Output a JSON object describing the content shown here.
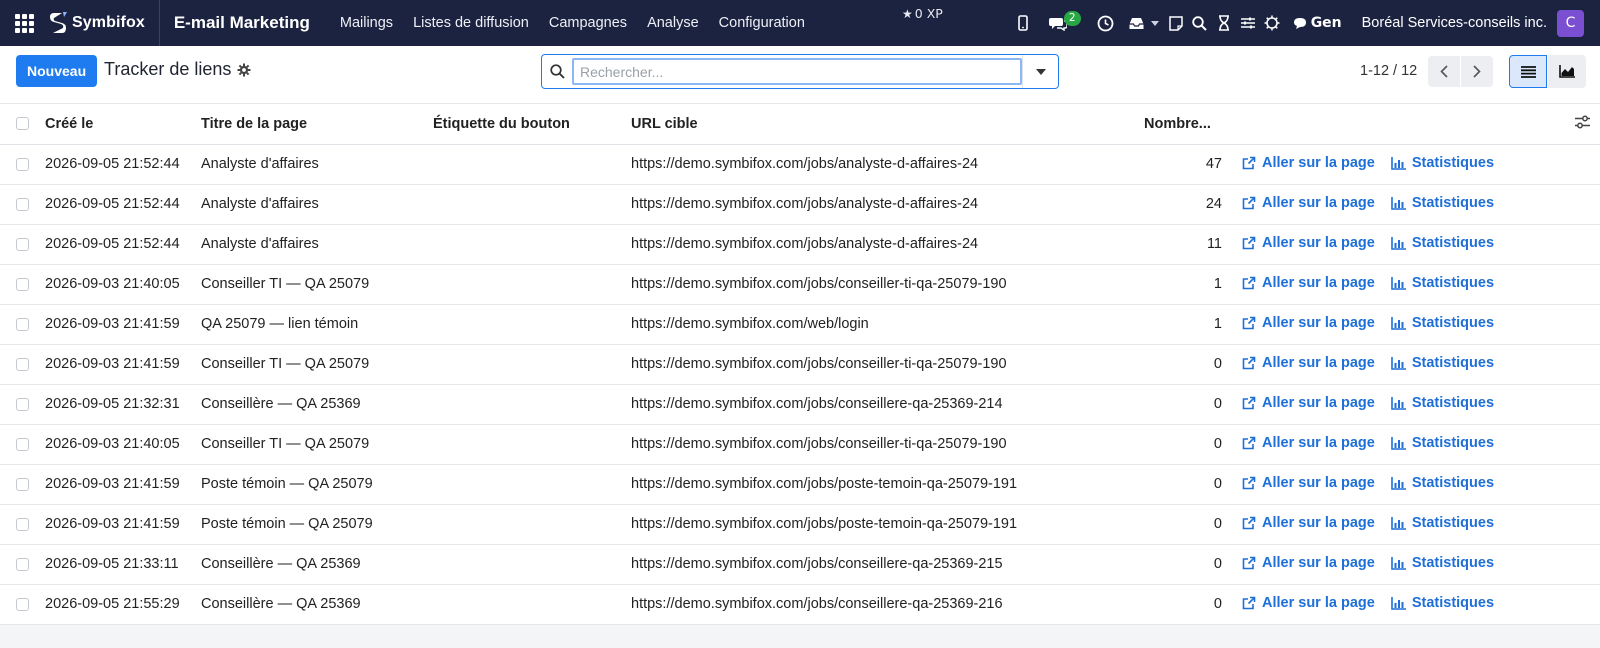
{
  "navbar": {
    "brand": "Symbifox",
    "app_title": "E-mail Marketing",
    "menu": [
      "Mailings",
      "Listes de diffusion",
      "Campagnes",
      "Analyse",
      "Configuration"
    ],
    "xp": "0 XP",
    "chat_count": "2",
    "gen_label": "Gen",
    "company": "Boréal Services-conseils inc.",
    "avatar_letter": "C"
  },
  "control": {
    "new_button": "Nouveau",
    "title": "Tracker de liens",
    "search_placeholder": "Rechercher...",
    "pager": "1-12 / 12"
  },
  "table": {
    "headers": {
      "created": "Créé le",
      "page_title": "Titre de la page",
      "button_label": "Étiquette du bouton",
      "target_url": "URL cible",
      "count": "Nombre..."
    },
    "action_go": "Aller sur la page",
    "action_stats": "Statistiques",
    "rows": [
      {
        "created": "2026-09-05 21:52:44",
        "title": "Analyste d'affaires",
        "label": "",
        "url": "https://demo.symbifox.com/jobs/analyste-d-affaires-24",
        "count": "47"
      },
      {
        "created": "2026-09-05 21:52:44",
        "title": "Analyste d'affaires",
        "label": "",
        "url": "https://demo.symbifox.com/jobs/analyste-d-affaires-24",
        "count": "24"
      },
      {
        "created": "2026-09-05 21:52:44",
        "title": "Analyste d'affaires",
        "label": "",
        "url": "https://demo.symbifox.com/jobs/analyste-d-affaires-24",
        "count": "11"
      },
      {
        "created": "2026-09-03 21:40:05",
        "title": "Conseiller TI — QA 25079",
        "label": "",
        "url": "https://demo.symbifox.com/jobs/conseiller-ti-qa-25079-190",
        "count": "1"
      },
      {
        "created": "2026-09-03 21:41:59",
        "title": "QA 25079 — lien témoin",
        "label": "",
        "url": "https://demo.symbifox.com/web/login",
        "count": "1"
      },
      {
        "created": "2026-09-03 21:41:59",
        "title": "Conseiller TI — QA 25079",
        "label": "",
        "url": "https://demo.symbifox.com/jobs/conseiller-ti-qa-25079-190",
        "count": "0"
      },
      {
        "created": "2026-09-05 21:32:31",
        "title": "Conseillère — QA 25369",
        "label": "",
        "url": "https://demo.symbifox.com/jobs/conseillere-qa-25369-214",
        "count": "0"
      },
      {
        "created": "2026-09-03 21:40:05",
        "title": "Conseiller TI — QA 25079",
        "label": "",
        "url": "https://demo.symbifox.com/jobs/conseiller-ti-qa-25079-190",
        "count": "0"
      },
      {
        "created": "2026-09-03 21:41:59",
        "title": "Poste témoin — QA 25079",
        "label": "",
        "url": "https://demo.symbifox.com/jobs/poste-temoin-qa-25079-191",
        "count": "0"
      },
      {
        "created": "2026-09-03 21:41:59",
        "title": "Poste témoin — QA 25079",
        "label": "",
        "url": "https://demo.symbifox.com/jobs/poste-temoin-qa-25079-191",
        "count": "0"
      },
      {
        "created": "2026-09-05 21:33:11",
        "title": "Conseillère — QA 25369",
        "label": "",
        "url": "https://demo.symbifox.com/jobs/conseillere-qa-25369-215",
        "count": "0"
      },
      {
        "created": "2026-09-05 21:55:29",
        "title": "Conseillère — QA 25369",
        "label": "",
        "url": "https://demo.symbifox.com/jobs/conseillere-qa-25369-216",
        "count": "0"
      }
    ]
  },
  "icons": {
    "apps": "apps-grid-icon",
    "star": "star-icon",
    "phone": "phone-icon",
    "chat": "chat-icon",
    "clock": "clock-icon",
    "inbox": "inbox-icon",
    "note": "note-icon",
    "search": "search-icon",
    "hourglass": "hourglass-icon",
    "sliders": "sliders-icon",
    "bug": "bug-icon",
    "gear": "gear-icon",
    "external_link": "external-link-icon",
    "bar_chart": "bar-chart-icon"
  },
  "colors": {
    "navbar_bg": "#1c2340",
    "primary": "#1f7cf0",
    "link": "#1f6fd8",
    "badge_green": "#28a745",
    "avatar_bg": "#7b4fd1"
  }
}
